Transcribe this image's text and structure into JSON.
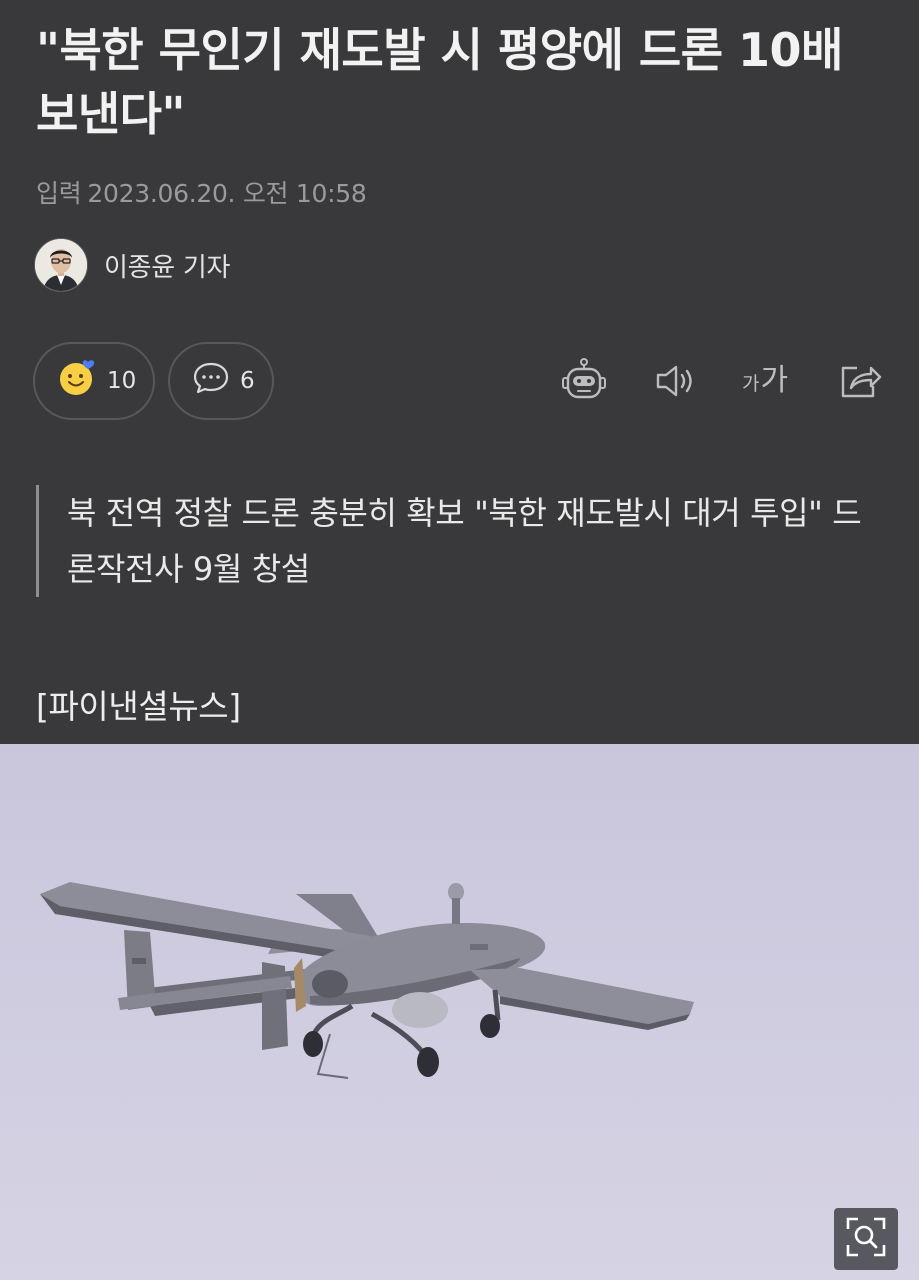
{
  "article": {
    "title": "\"북한 무인기 재도발 시 평양에 드론 10배 보낸다\"",
    "date_label": "입력",
    "date": "2023.06.20. 오전 10:58",
    "author": "이종윤 기자",
    "summary": "북 전역 정찰 드론 충분히 확보 \"북한 재도발시 대거 투입\" 드론작전사 9월 창설",
    "source": "[파이낸셜뉴스]"
  },
  "actions": {
    "reactions_count": "10",
    "comments_count": "6",
    "font_size_label_small": "가",
    "font_size_label_large": "가"
  },
  "icons": {
    "reaction": "smiley-face-icon",
    "comment": "speech-bubble-icon",
    "summary_bot": "robot-icon",
    "tts": "speaker-icon",
    "font_size": "font-size-icon",
    "share": "share-icon",
    "zoom": "zoom-icon"
  },
  "colors": {
    "background": "#39393b",
    "text": "#f2f2f2",
    "meta": "#9a9a9c",
    "sky": "#cfcce0"
  }
}
